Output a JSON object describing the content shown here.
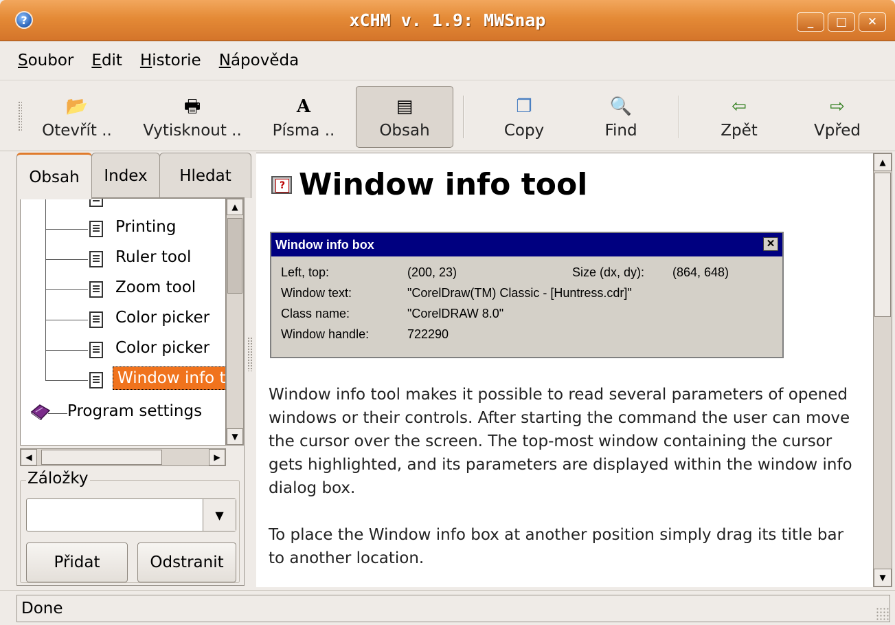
{
  "window": {
    "title": "xCHM v. 1.9: MWSnap",
    "minimize_label": "_",
    "maximize_label": "□",
    "close_label": "✕"
  },
  "menu": [
    {
      "label": "Soubor",
      "mnemonic": "S",
      "rest": "oubor"
    },
    {
      "label": "Edit",
      "mnemonic": "E",
      "rest": "dit"
    },
    {
      "label": "Historie",
      "mnemonic": "H",
      "rest": "istorie"
    },
    {
      "label": "Nápověda",
      "mnemonic": "N",
      "rest": "ápověda"
    }
  ],
  "toolbar": {
    "open": {
      "label": "Otevřít ..",
      "icon": "📂"
    },
    "print": {
      "label": "Vytisknout ..",
      "icon": "🖶"
    },
    "fonts": {
      "label": "Písma ..",
      "icon": "A"
    },
    "contents": {
      "label": "Obsah",
      "icon": "▤"
    },
    "copy": {
      "label": "Copy",
      "icon": "❐"
    },
    "find": {
      "label": "Find",
      "icon": "🔍"
    },
    "back": {
      "label": "Zpět",
      "icon": "⇦"
    },
    "forward": {
      "label": "Vpřed",
      "icon": "⇨"
    }
  },
  "tabs": {
    "contents": "Obsah",
    "index": "Index",
    "search": "Hledat"
  },
  "tree": {
    "items": [
      {
        "label": "Printing"
      },
      {
        "label": "Ruler tool"
      },
      {
        "label": "Zoom tool"
      },
      {
        "label": "Color picker"
      },
      {
        "label": "Color picker"
      },
      {
        "label": "Window info tool"
      }
    ],
    "root_item": "Program settings"
  },
  "bookmarks": {
    "label": "Záložky",
    "value": "",
    "add_label": "Přidat",
    "remove_label": "Odstranit"
  },
  "content": {
    "title": "Window info tool",
    "infobox": {
      "title": "Window info box",
      "rows": [
        {
          "label": "Left, top:",
          "value": "(200, 23)"
        },
        {
          "label": "Window text:",
          "value": "\"CorelDraw(TM) Classic - [Huntress.cdr]\""
        },
        {
          "label": "Class name:",
          "value": "\"CorelDRAW 8.0\""
        },
        {
          "label": "Window handle:",
          "value": "722290"
        }
      ],
      "size_label": "Size (dx, dy):",
      "size_value": "(864, 648)"
    },
    "paragraph1": "Window info tool makes it possible to read several parameters of opened windows or their controls. After starting the command the user can move the cursor over the screen. The top-most window containing the cursor gets highlighted, and its parameters are displayed within the window info dialog box.",
    "paragraph2": "To place the Window info box at another position simply drag its title bar to another location."
  },
  "status": {
    "text": "Done"
  }
}
